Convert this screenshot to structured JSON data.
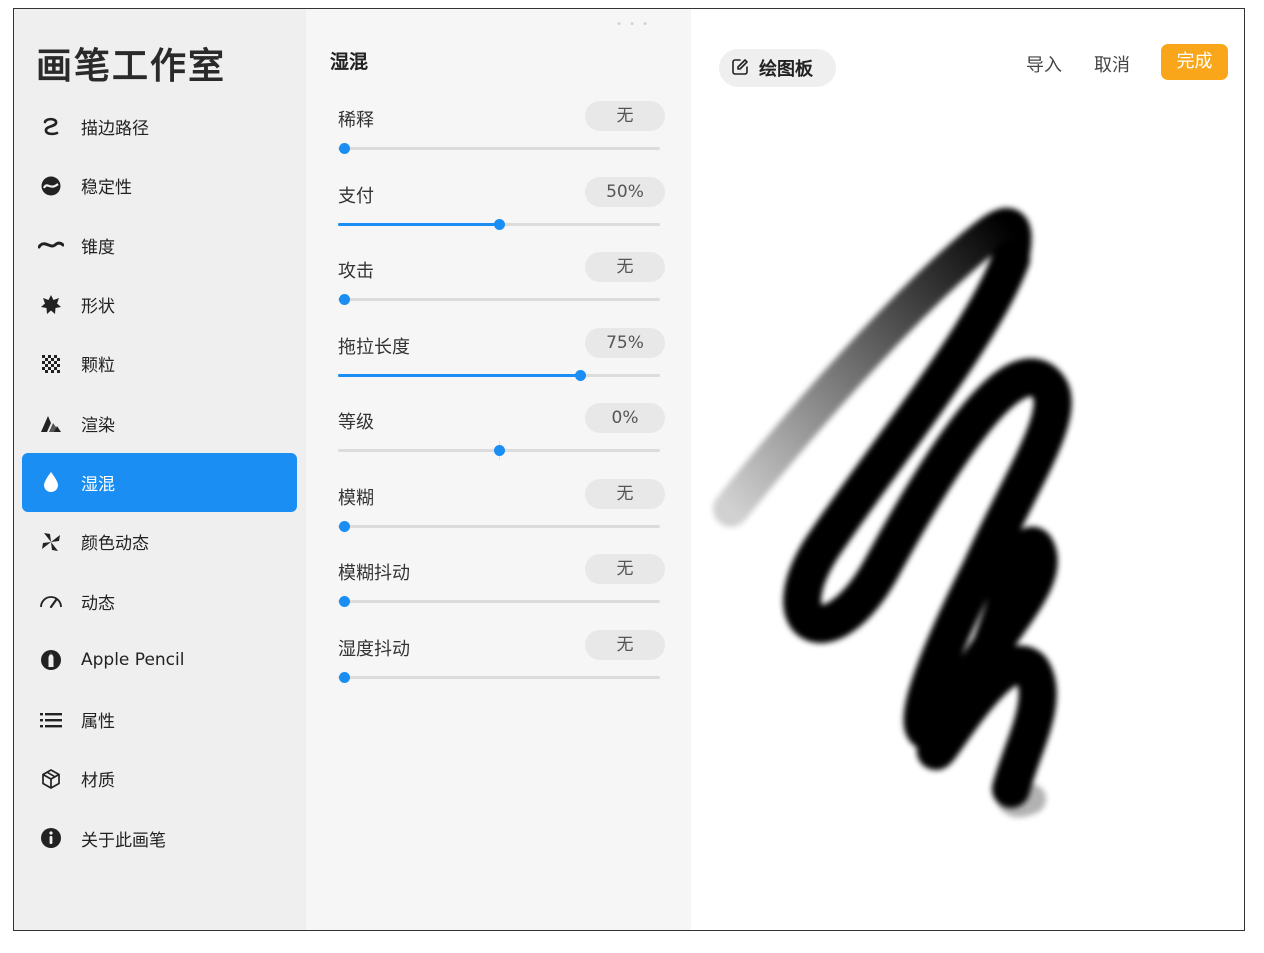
{
  "sidebar": {
    "title": "画笔工作室",
    "items": [
      {
        "label": "描边路径",
        "icon": "stroke-path-icon"
      },
      {
        "label": "稳定性",
        "icon": "stabilization-icon"
      },
      {
        "label": "锥度",
        "icon": "taper-icon"
      },
      {
        "label": "形状",
        "icon": "shape-icon"
      },
      {
        "label": "颗粒",
        "icon": "grain-icon"
      },
      {
        "label": "渲染",
        "icon": "rendering-icon"
      },
      {
        "label": "湿混",
        "icon": "wet-mix-icon"
      },
      {
        "label": "颜色动态",
        "icon": "color-dynamics-icon"
      },
      {
        "label": "动态",
        "icon": "dynamics-icon"
      },
      {
        "label": "Apple Pencil",
        "icon": "apple-pencil-icon"
      },
      {
        "label": "属性",
        "icon": "properties-icon"
      },
      {
        "label": "材质",
        "icon": "materials-icon"
      },
      {
        "label": "关于此画笔",
        "icon": "info-icon"
      }
    ],
    "active_index": 6,
    "accent_color": "#1a8ef2"
  },
  "settings": {
    "section_title": "湿混",
    "rows": [
      {
        "label": "稀释",
        "value": "无",
        "fraction": 0
      },
      {
        "label": "支付",
        "value": "50%",
        "fraction": 0.5
      },
      {
        "label": "攻击",
        "value": "无",
        "fraction": 0
      },
      {
        "label": "拖拉长度",
        "value": "75%",
        "fraction": 0.75
      },
      {
        "label": "等级",
        "value": "0%",
        "fraction": 0.5,
        "centered": true
      },
      {
        "label": "模糊",
        "value": "无",
        "fraction": 0
      },
      {
        "label": "模糊抖动",
        "value": "无",
        "fraction": 0
      },
      {
        "label": "湿度抖动",
        "value": "无",
        "fraction": 0
      }
    ]
  },
  "canvas": {
    "drawing_pad_label": "绘图板",
    "drawing_pad_icon": "edit-icon",
    "import_label": "导入",
    "cancel_label": "取消",
    "done_label": "完成",
    "done_color": "#f9a61a"
  }
}
